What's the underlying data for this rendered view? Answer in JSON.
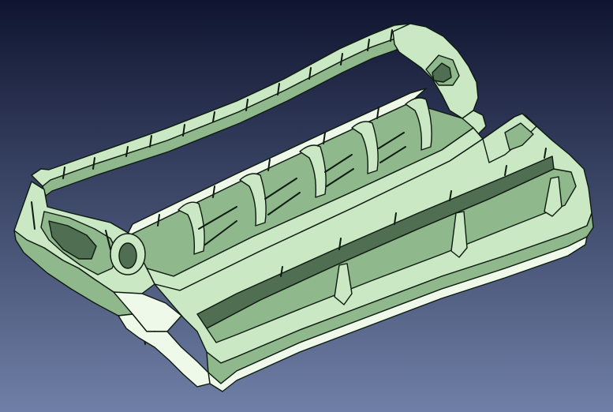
{
  "viewport": {
    "background_top": "#0f1530",
    "background_bottom": "#6f7fa6"
  },
  "model": {
    "fill_color": "#c9e8c3",
    "fill_shadow": "#8fb98c",
    "fill_dark": "#4f6e52",
    "edge_color": "#0e1a0f",
    "highlight_color": "#eef9ea"
  }
}
